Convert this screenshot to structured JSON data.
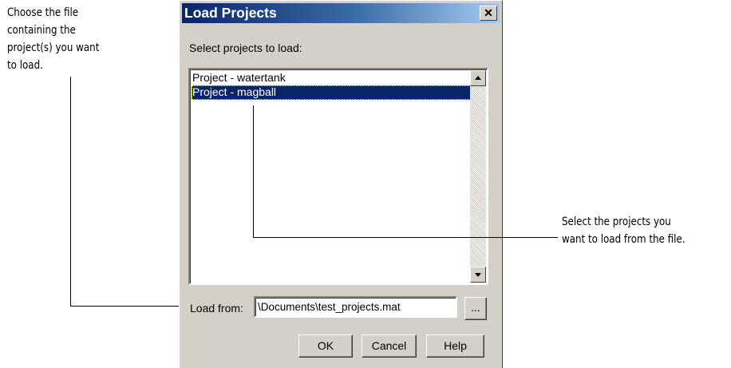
{
  "callouts": {
    "left": [
      "Choose the file",
      "containing the",
      "project(s) you want",
      "to load."
    ],
    "right": [
      "Select the projects you",
      "want to load from the file."
    ]
  },
  "dialog": {
    "title": "Load Projects",
    "close_glyph": "✕",
    "prompt": "Select projects to load:",
    "projects": [
      {
        "label": "Project - watertank",
        "selected": false
      },
      {
        "label": "Project - magball",
        "selected": true
      }
    ],
    "load_from_label": "Load from:",
    "load_from_value": "\\Documents\\test_projects.mat",
    "browse_label": "...",
    "ok_label": "OK",
    "cancel_label": "Cancel",
    "help_label": "Help"
  },
  "icons": {
    "close": "close-icon",
    "scroll_up": "scroll-up-arrow-icon",
    "scroll_down": "scroll-down-arrow-icon"
  },
  "colors": {
    "title_gradient_start": "#0a246a",
    "title_gradient_end": "#a6caf0",
    "dialog_face": "#d4d0c8",
    "selection": "#0a246a"
  }
}
